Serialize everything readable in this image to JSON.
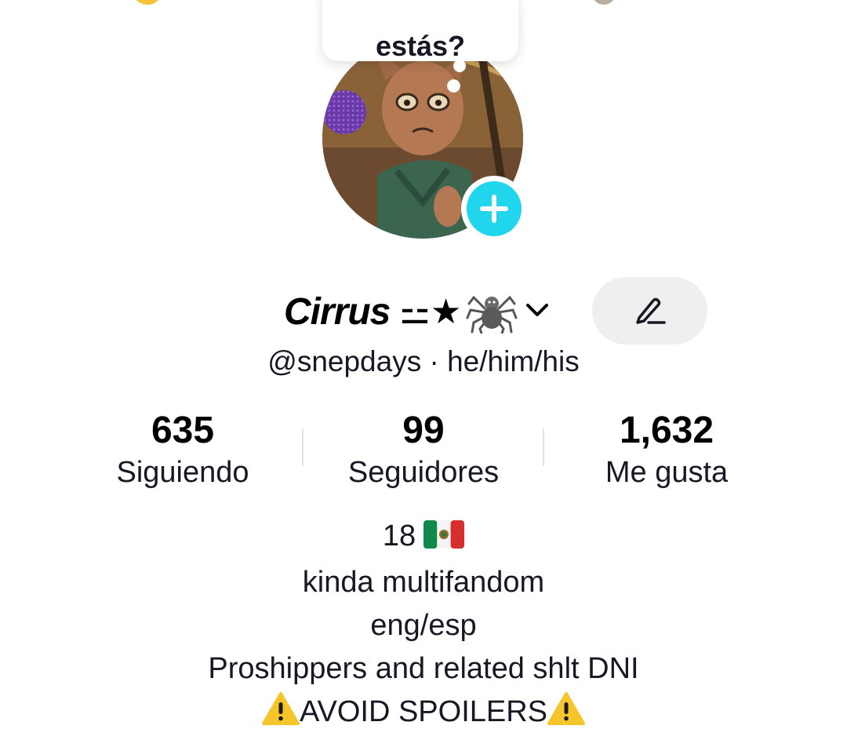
{
  "bubble": {
    "text": "estás?"
  },
  "profile": {
    "display_name": "Cirrus",
    "name_decoration": "⚍★",
    "name_emoji": "🕷️",
    "handle": "@snepdays · he/him/his"
  },
  "stats": [
    {
      "value": "635",
      "label": "Siguiendo"
    },
    {
      "value": "99",
      "label": "Seguidores"
    },
    {
      "value": "1,632",
      "label": "Me gusta"
    }
  ],
  "bio": {
    "age": "18",
    "flag_icon": "mexico-flag-icon",
    "line2": "kinda multifandom",
    "line3": "eng/esp",
    "line4": "Proshippers and related shlt DNI",
    "line5": "AVOID SPOILERS",
    "warning_icon": "warning-icon"
  },
  "colors": {
    "accent": "#20d5ec",
    "text": "#161823",
    "edit_button_bg": "#efefef"
  }
}
